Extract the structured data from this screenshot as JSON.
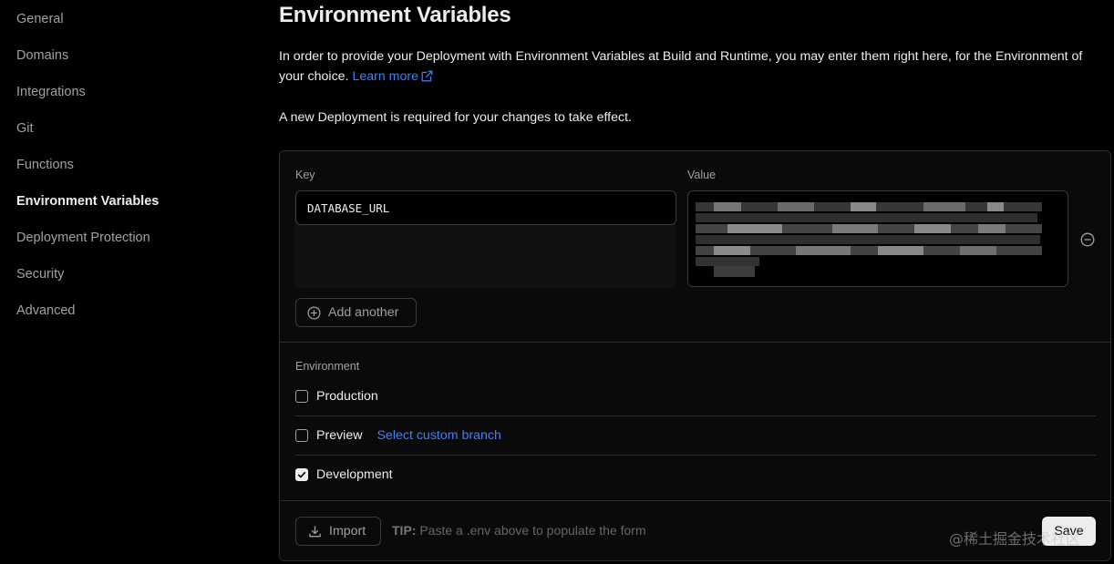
{
  "sidebar": {
    "items": [
      {
        "label": "General"
      },
      {
        "label": "Domains"
      },
      {
        "label": "Integrations"
      },
      {
        "label": "Git"
      },
      {
        "label": "Functions"
      },
      {
        "label": "Environment Variables",
        "active": true
      },
      {
        "label": "Deployment Protection"
      },
      {
        "label": "Security"
      },
      {
        "label": "Advanced"
      }
    ]
  },
  "page": {
    "title": "Environment Variables",
    "description": "In order to provide your Deployment with Environment Variables at Build and Runtime, you may enter them right here, for the Environment of your choice.",
    "learn_more": "Learn more",
    "note": "A new Deployment is required for your changes to take effect."
  },
  "form": {
    "key_label": "Key",
    "value_label": "Value",
    "key_value": "DATABASE_URL",
    "value_state": "blurred",
    "add_another_label": "Add another",
    "environment_label": "Environment",
    "environments": [
      {
        "label": "Production",
        "checked": false
      },
      {
        "label": "Preview",
        "checked": false,
        "link": "Select custom branch"
      },
      {
        "label": "Development",
        "checked": true
      }
    ],
    "import_label": "Import",
    "tip_prefix": "TIP:",
    "tip_text": "Paste a .env above to populate the form",
    "save_label": "Save"
  },
  "watermark": "@稀土掘金技术社区",
  "colors": {
    "background": "#000000",
    "card": "#0a0a0a",
    "link": "#3b82f6",
    "muted_text": "#a1a1a1",
    "border": "#2e2e2e"
  },
  "icons": {
    "external_link": "external-link-icon",
    "add": "plus-circle-icon",
    "remove": "minus-circle-icon",
    "import": "download-icon",
    "check": "check-icon"
  }
}
